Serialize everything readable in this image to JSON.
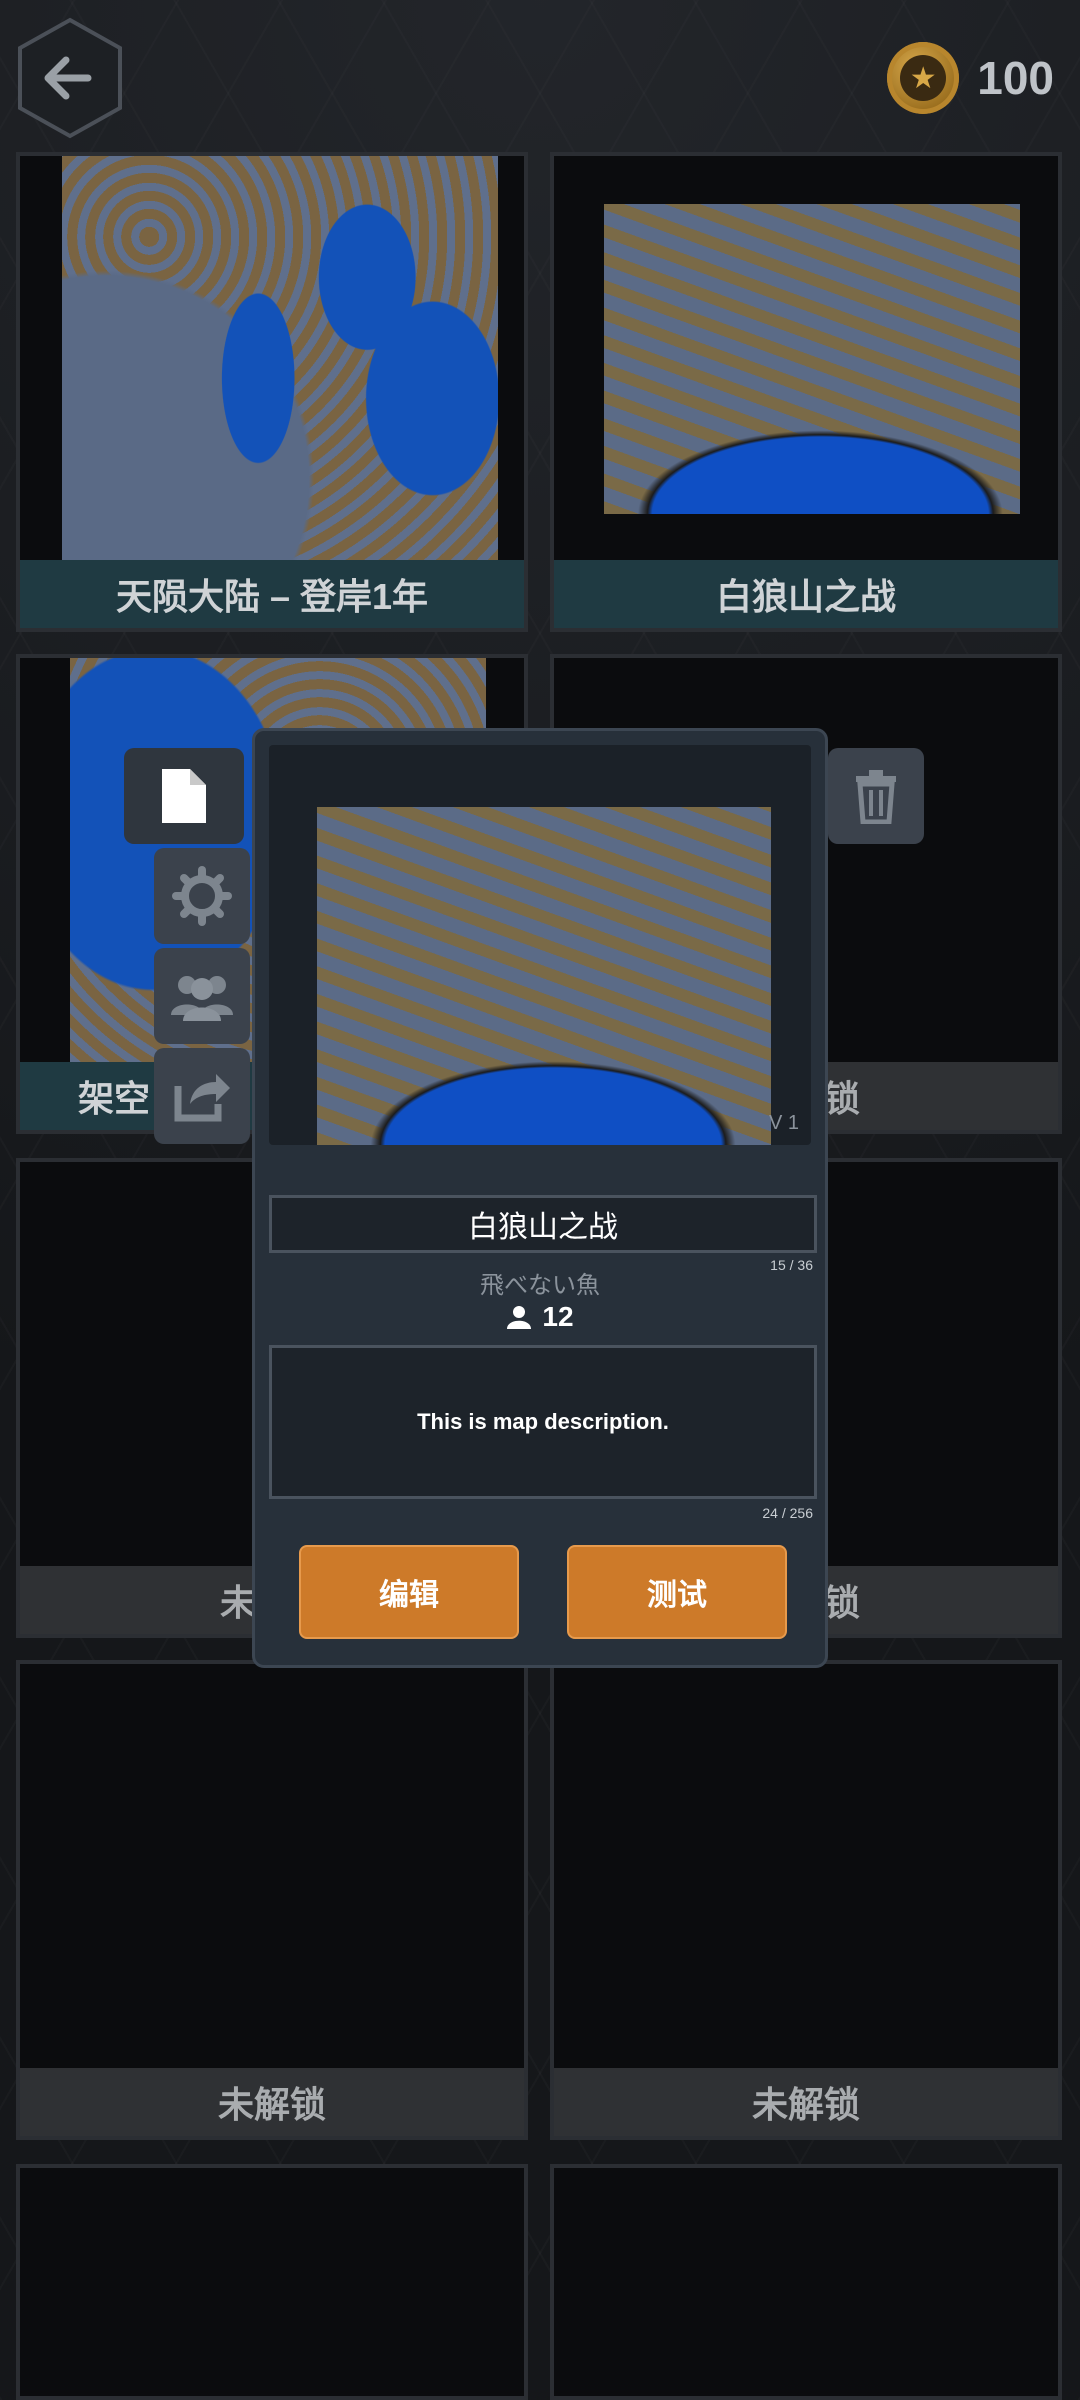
{
  "coins": "100",
  "grid": {
    "cards": [
      {
        "label": "天陨大陆 – 登岸1年"
      },
      {
        "label": "白狼山之战"
      },
      {
        "label": "架空"
      },
      {
        "label": "锁"
      },
      {
        "label": "未"
      },
      {
        "label": "锁"
      },
      {
        "label": "未解锁"
      },
      {
        "label": "未解锁"
      }
    ]
  },
  "popup": {
    "version": "V 1",
    "map_name": "白狼山之战",
    "name_count": "15 / 36",
    "author": "飛べない魚",
    "players": "12",
    "description": "This is map description.",
    "desc_count": "24 / 256",
    "edit_label": "编辑",
    "test_label": "测试"
  },
  "colors": {
    "accent": "#cd7a29",
    "panel": "#27303a"
  }
}
